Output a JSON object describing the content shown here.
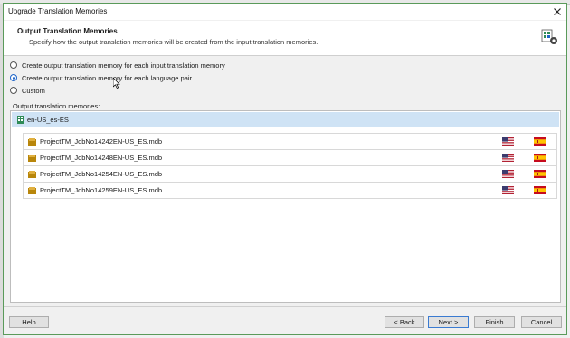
{
  "window": {
    "title": "Upgrade Translation Memories"
  },
  "header": {
    "title": "Output Translation Memories",
    "subtitle": "Specify how the output translation memories will be created from the input translation memories."
  },
  "options": [
    {
      "label": "Create output translation memory for each input translation memory",
      "checked": false
    },
    {
      "label": "Create output translation memory for each language pair",
      "checked": true
    },
    {
      "label": "Custom",
      "checked": false
    }
  ],
  "list": {
    "label": "Output translation memories:",
    "group": "en-US_es-ES",
    "items": [
      {
        "name": "ProjectTM_JobNo14242EN-US_ES.mdb"
      },
      {
        "name": "ProjectTM_JobNo14248EN-US_ES.mdb"
      },
      {
        "name": "ProjectTM_JobNo14254EN-US_ES.mdb"
      },
      {
        "name": "ProjectTM_JobNo14259EN-US_ES.mdb"
      }
    ]
  },
  "buttons": {
    "help": "Help",
    "back": "< Back",
    "next": "Next >",
    "finish": "Finish",
    "cancel": "Cancel"
  },
  "icons": {
    "close": "close-icon",
    "header": "translation-memory-settings-icon",
    "group": "language-pair-icon",
    "tm": "translation-memory-icon",
    "source_flag": "us-flag-icon",
    "target_flag": "spain-flag-icon"
  },
  "colors": {
    "selection": "#cfe3f5",
    "accent": "#1e64c8",
    "frame": "#5a9a5a"
  }
}
